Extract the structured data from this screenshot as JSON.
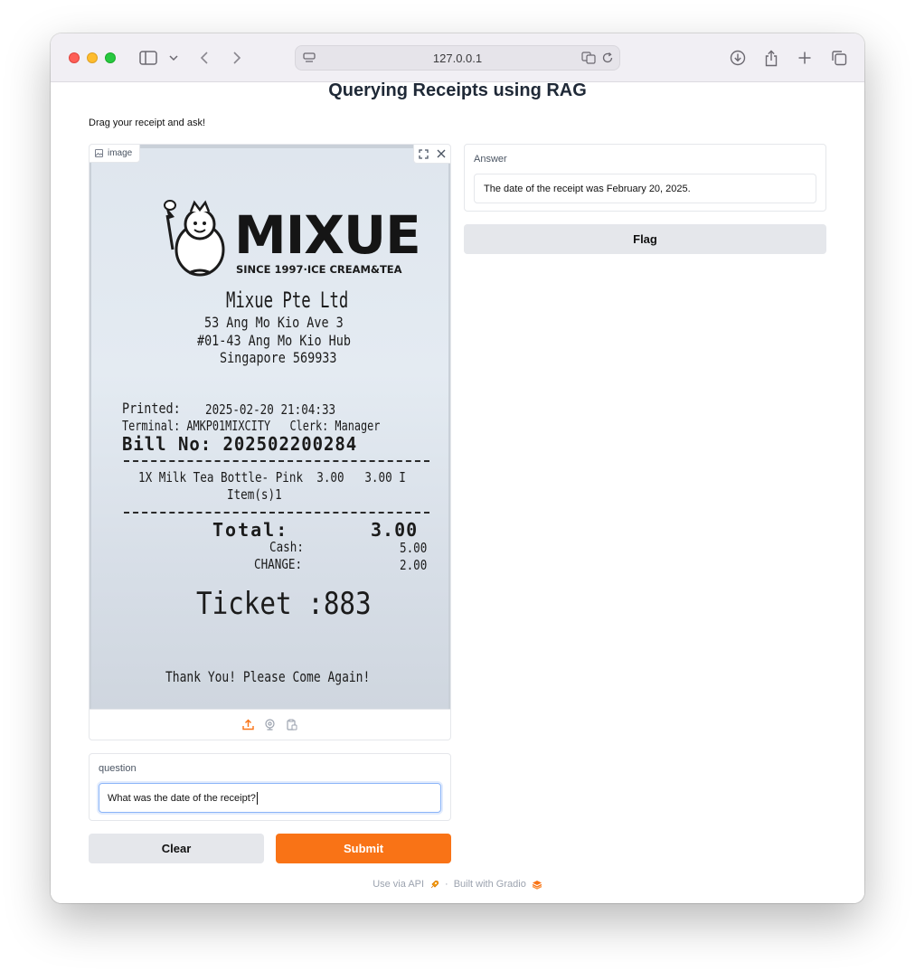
{
  "browser": {
    "url": "127.0.0.1"
  },
  "page": {
    "title": "Querying Receipts using RAG",
    "description": "Drag your receipt and ask!"
  },
  "image_input": {
    "label": "image",
    "receipt": {
      "brand": "MIXUE",
      "tagline": "SINCE 1997·ICE CREAM&TEA",
      "company": "Mixue Pte Ltd",
      "address_lines": [
        "53 Ang Mo Kio Ave 3",
        "#01-43 Ang Mo Kio Hub",
        "Singapore 569933"
      ],
      "printed_label": "Printed:",
      "printed_value": "2025-02-20 21:04:33",
      "terminal_line": "Terminal: AMKP01MIXCITY   Clerk: Manager",
      "bill_line": "Bill No: 202502200284",
      "item_line": "1X Milk Tea Bottle- Pink  3.00   3.00 I",
      "items_count": "Item(s)1",
      "total_label": "Total:",
      "total_value": "3.00",
      "cash_label": "Cash:",
      "cash_value": "5.00",
      "change_label": "CHANGE:",
      "change_value": "2.00",
      "ticket": "Ticket :883",
      "thanks": "Thank You! Please Come Again!"
    }
  },
  "question": {
    "label": "question",
    "value": "What was the date of the receipt?"
  },
  "answer": {
    "label": "Answer",
    "value": "The date of the receipt was February 20, 2025."
  },
  "buttons": {
    "flag": "Flag",
    "clear": "Clear",
    "submit": "Submit"
  },
  "footer": {
    "api": "Use via API",
    "separator": "·",
    "built": "Built with Gradio"
  },
  "colors": {
    "accent": "#f97316",
    "secondary_button": "#e5e7eb"
  }
}
